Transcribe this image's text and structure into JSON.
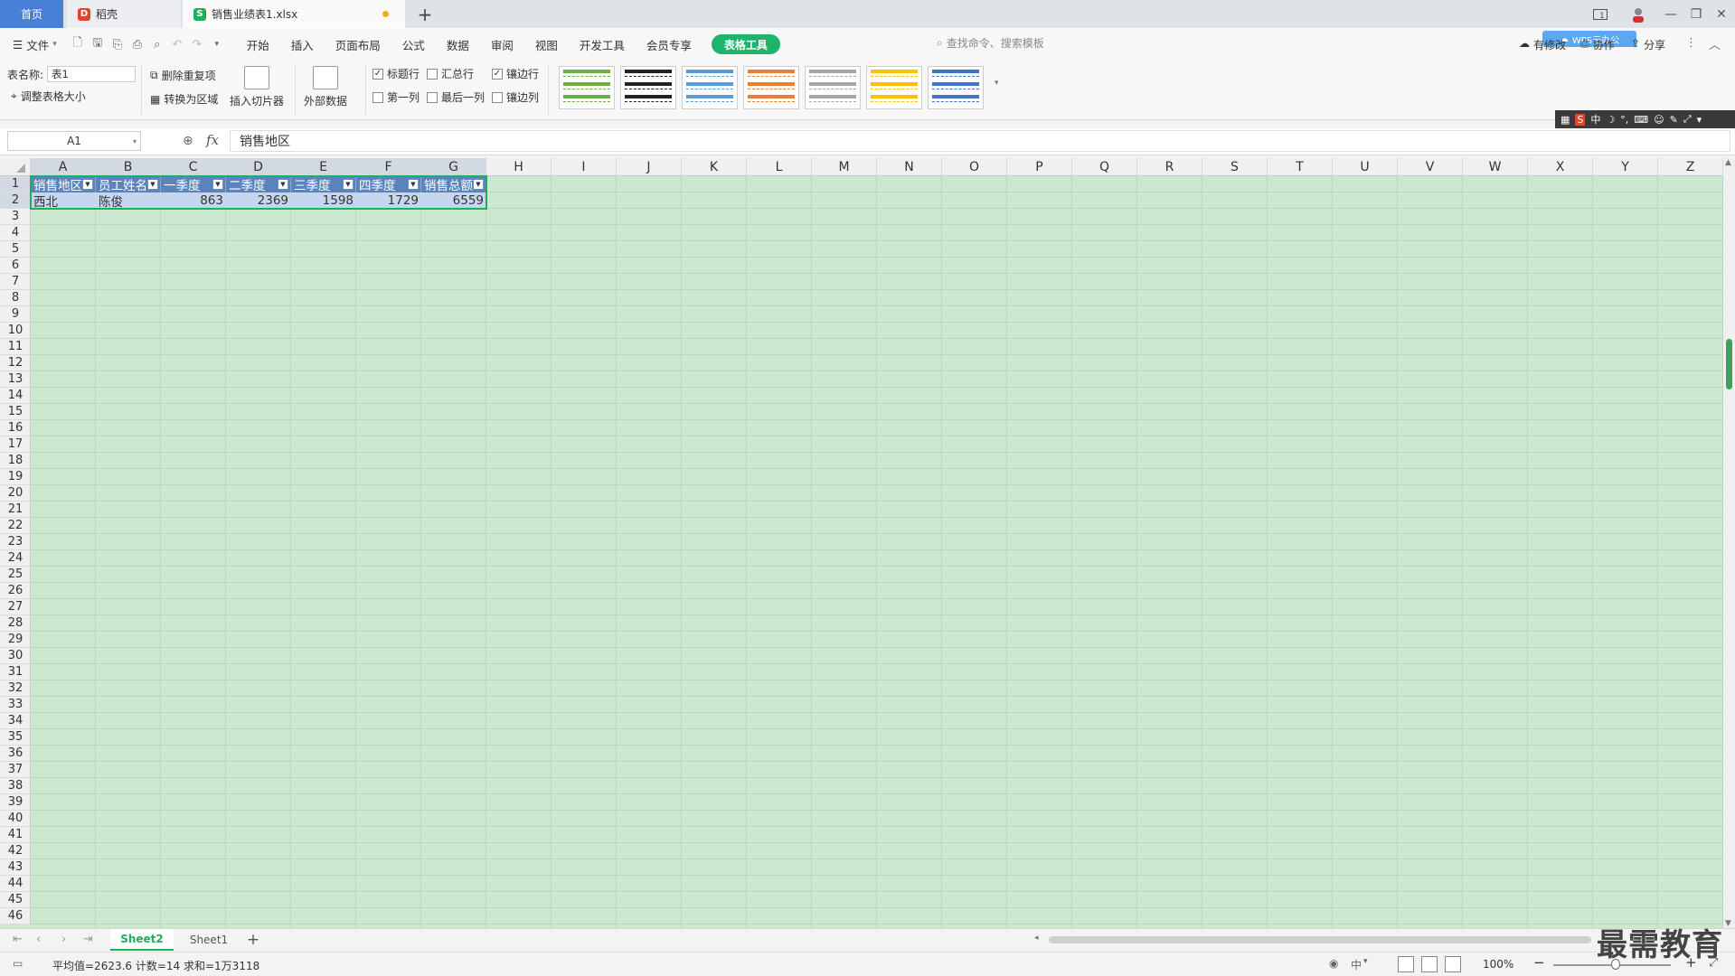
{
  "tabs": {
    "home": "首页",
    "daoke": "稻壳",
    "file": "销售业绩表1.xlsx",
    "new_tab": "+"
  },
  "menu": {
    "file": "文件",
    "items": [
      "开始",
      "插入",
      "页面布局",
      "公式",
      "数据",
      "审阅",
      "视图",
      "开发工具",
      "会员专享"
    ],
    "table_tools": "表格工具",
    "search_placeholder": "查找命令、搜索模板",
    "sync": "有修改",
    "collab": "协作",
    "share": "分享",
    "cloud_badge": "WPS云办公"
  },
  "ribbon": {
    "table_name_label": "表名称:",
    "table_name_value": "表1",
    "resize_table": "调整表格大小",
    "remove_duplicates": "删除重复项",
    "convert_range": "转换为区域",
    "insert_slicer": "插入切片器",
    "external_data": "外部数据",
    "opt_header_row": "标题行",
    "opt_total_row": "汇总行",
    "opt_banded_rows": "镶边行",
    "opt_first_col": "第一列",
    "opt_last_col": "最后一列",
    "opt_banded_cols": "镶边列",
    "check_header_row": true,
    "check_total_row": false,
    "check_banded_rows": true,
    "check_first_col": false,
    "check_last_col": false,
    "check_banded_cols": false,
    "table_styles": [
      "green",
      "black",
      "blue",
      "orange",
      "gray",
      "yellow",
      "navy"
    ],
    "style_colors": [
      "#70ad47",
      "#222222",
      "#5b9bd5",
      "#ed7d31",
      "#a5a5a5",
      "#ffc000",
      "#4472c4"
    ]
  },
  "ime": {
    "mode": "中"
  },
  "formula_bar": {
    "cell_ref": "A1",
    "fx": "fx",
    "content": "销售地区"
  },
  "grid": {
    "columns": [
      "A",
      "B",
      "C",
      "D",
      "E",
      "F",
      "G",
      "H",
      "I",
      "J",
      "K",
      "L",
      "M",
      "N",
      "O",
      "P",
      "Q",
      "R",
      "S",
      "T",
      "U",
      "V",
      "W",
      "X",
      "Y",
      "Z"
    ],
    "row_count": 46,
    "table_headers": [
      "销售地区",
      "员工姓名",
      "一季度",
      "二季度",
      "三季度",
      "四季度",
      "销售总额"
    ],
    "row2": [
      "西北",
      "陈俊",
      "863",
      "2369",
      "1598",
      "1729",
      "6559"
    ]
  },
  "sheets": {
    "active": "Sheet2",
    "other": "Sheet1",
    "add": "+"
  },
  "status": {
    "summary": "平均值=2623.6  计数=14  求和=1万3118",
    "ime_mode": "中",
    "zoom": "100%"
  },
  "watermark": "最需教育"
}
